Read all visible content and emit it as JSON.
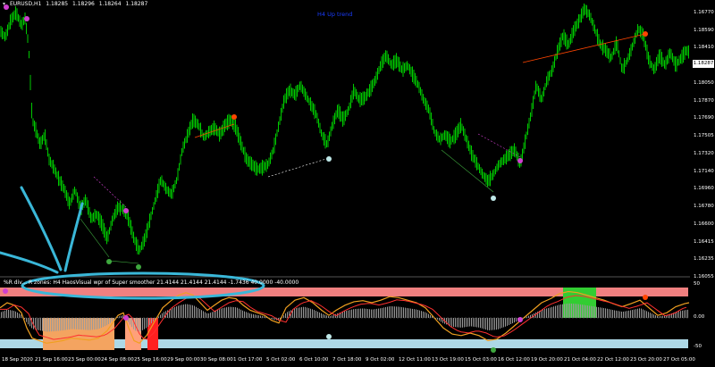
{
  "window": {
    "symbol_icon": "down-arrow-icon",
    "symbol": "EURUSD,H1",
    "ohlc": [
      "1.18285",
      "1.18296",
      "1.18264",
      "1.18287"
    ],
    "center_title": "H4 Up trend"
  },
  "indicator": {
    "caption": "%R div... R zones: H4 HaosVisual wpr of Super smoother 21.4144 21.4144 21.4144 -1.7436 40.0000 -40.0000",
    "axis": [
      "50",
      "0.00",
      "-50"
    ]
  },
  "price_axis": [
    "1.16770",
    "1.18590",
    "1.18410",
    "1.18230",
    "1.18050",
    "1.17870",
    "1.17690",
    "1.17505",
    "1.17320",
    "1.17140",
    "1.16960",
    "1.16780",
    "1.16600",
    "1.16415",
    "1.16235",
    "1.16055"
  ],
  "current_price": "1.18287",
  "time_axis": [
    "18 Sep 2020",
    "21 Sep 16:00",
    "23 Sep 00:00",
    "24 Sep 08:00",
    "25 Sep 16:00",
    "29 Sep 00:00",
    "30 Sep 08:00",
    "1 Oct 17:00",
    "5 Oct 02:00",
    "6 Oct 10:00",
    "7 Oct 18:00",
    "9 Oct 02:00",
    "12 Oct 11:00",
    "13 Oct 19:00",
    "15 Oct 03:00",
    "16 Oct 12:00",
    "19 Oct 20:00",
    "21 Oct 04:00",
    "22 Oct 12:00",
    "23 Oct 20:00",
    "27 Oct 05:00"
  ],
  "colors": {
    "background": "#000000",
    "candles": "#00c800",
    "bear_div": "#ff4500",
    "bull_div": "#ffffff",
    "up_zone": "#f08080",
    "down_zone": "#add8e6",
    "annotation": "#3ab7d8",
    "title": "#1a3cff"
  },
  "price_path": [
    [
      0,
      1.185
    ],
    [
      6,
      1.1843
    ],
    [
      12,
      1.186
    ],
    [
      18,
      1.1868
    ],
    [
      24,
      1.1855
    ],
    [
      28,
      1.1862
    ],
    [
      32,
      1.1835
    ],
    [
      36,
      1.176
    ],
    [
      40,
      1.175
    ],
    [
      45,
      1.1735
    ],
    [
      50,
      1.1745
    ],
    [
      55,
      1.172
    ],
    [
      60,
      1.1712
    ],
    [
      66,
      1.17
    ],
    [
      72,
      1.169
    ],
    [
      78,
      1.1675
    ],
    [
      84,
      1.169
    ],
    [
      90,
      1.167
    ],
    [
      96,
      1.168
    ],
    [
      102,
      1.166
    ],
    [
      108,
      1.1665
    ],
    [
      114,
      1.1655
    ],
    [
      120,
      1.164
    ],
    [
      126,
      1.166
    ],
    [
      132,
      1.1672
    ],
    [
      138,
      1.167
    ],
    [
      144,
      1.166
    ],
    [
      150,
      1.164
    ],
    [
      156,
      1.1628
    ],
    [
      162,
      1.164
    ],
    [
      168,
      1.166
    ],
    [
      174,
      1.168
    ],
    [
      180,
      1.17
    ],
    [
      186,
      1.169
    ],
    [
      192,
      1.1685
    ],
    [
      198,
      1.17
    ],
    [
      204,
      1.173
    ],
    [
      210,
      1.1745
    ],
    [
      216,
      1.176
    ],
    [
      222,
      1.1755
    ],
    [
      228,
      1.1742
    ],
    [
      234,
      1.1748
    ],
    [
      240,
      1.1752
    ],
    [
      246,
      1.1745
    ],
    [
      252,
      1.1755
    ],
    [
      258,
      1.176
    ],
    [
      264,
      1.1752
    ],
    [
      270,
      1.1735
    ],
    [
      276,
      1.172
    ],
    [
      282,
      1.1715
    ],
    [
      288,
      1.171
    ],
    [
      294,
      1.1712
    ],
    [
      300,
      1.1715
    ],
    [
      306,
      1.173
    ],
    [
      312,
      1.1755
    ],
    [
      318,
      1.178
    ],
    [
      324,
      1.179
    ],
    [
      330,
      1.1785
    ],
    [
      336,
      1.1795
    ],
    [
      342,
      1.1785
    ],
    [
      348,
      1.1775
    ],
    [
      354,
      1.1765
    ],
    [
      360,
      1.1745
    ],
    [
      366,
      1.1735
    ],
    [
      372,
      1.1755
    ],
    [
      378,
      1.177
    ],
    [
      384,
      1.176
    ],
    [
      390,
      1.177
    ],
    [
      396,
      1.179
    ],
    [
      402,
      1.178
    ],
    [
      408,
      1.1782
    ],
    [
      414,
      1.179
    ],
    [
      420,
      1.18
    ],
    [
      426,
      1.1815
    ],
    [
      432,
      1.1825
    ],
    [
      438,
      1.1815
    ],
    [
      444,
      1.182
    ],
    [
      450,
      1.181
    ],
    [
      456,
      1.1815
    ],
    [
      462,
      1.1805
    ],
    [
      468,
      1.1795
    ],
    [
      474,
      1.178
    ],
    [
      480,
      1.177
    ],
    [
      486,
      1.1748
    ],
    [
      492,
      1.174
    ],
    [
      498,
      1.1745
    ],
    [
      504,
      1.1738
    ],
    [
      510,
      1.1745
    ],
    [
      516,
      1.1755
    ],
    [
      522,
      1.174
    ],
    [
      528,
      1.1725
    ],
    [
      534,
      1.1715
    ],
    [
      540,
      1.1705
    ],
    [
      546,
      1.1698
    ],
    [
      552,
      1.1705
    ],
    [
      558,
      1.1715
    ],
    [
      564,
      1.172
    ],
    [
      570,
      1.1725
    ],
    [
      576,
      1.173
    ],
    [
      582,
      1.1715
    ],
    [
      588,
      1.174
    ],
    [
      594,
      1.1765
    ],
    [
      600,
      1.1795
    ],
    [
      606,
      1.178
    ],
    [
      612,
      1.18
    ],
    [
      618,
      1.181
    ],
    [
      624,
      1.183
    ],
    [
      630,
      1.1845
    ],
    [
      636,
      1.1835
    ],
    [
      642,
      1.185
    ],
    [
      648,
      1.186
    ],
    [
      654,
      1.1872
    ],
    [
      660,
      1.1865
    ],
    [
      666,
      1.185
    ],
    [
      672,
      1.1835
    ],
    [
      678,
      1.183
    ],
    [
      684,
      1.1822
    ],
    [
      690,
      1.1838
    ],
    [
      696,
      1.181
    ],
    [
      702,
      1.182
    ],
    [
      708,
      1.1835
    ],
    [
      714,
      1.1852
    ],
    [
      720,
      1.1845
    ],
    [
      726,
      1.182
    ],
    [
      732,
      1.181
    ],
    [
      738,
      1.1825
    ],
    [
      744,
      1.1815
    ],
    [
      750,
      1.1828
    ],
    [
      756,
      1.1815
    ],
    [
      762,
      1.1822
    ],
    [
      768,
      1.183
    ],
    [
      771,
      1.1828
    ]
  ],
  "price_scale": {
    "min": 1.16055,
    "max": 1.1877
  },
  "indicator_wpr": [
    [
      0,
      20
    ],
    [
      8,
      30
    ],
    [
      16,
      25
    ],
    [
      24,
      10
    ],
    [
      30,
      -20
    ],
    [
      36,
      -40
    ],
    [
      44,
      -45
    ],
    [
      52,
      -50
    ],
    [
      60,
      -48
    ],
    [
      70,
      -45
    ],
    [
      80,
      -40
    ],
    [
      90,
      -42
    ],
    [
      100,
      -44
    ],
    [
      110,
      -40
    ],
    [
      120,
      -25
    ],
    [
      126,
      -10
    ],
    [
      132,
      5
    ],
    [
      138,
      10
    ],
    [
      144,
      -20
    ],
    [
      150,
      -45
    ],
    [
      156,
      -50
    ],
    [
      164,
      -35
    ],
    [
      172,
      -10
    ],
    [
      182,
      20
    ],
    [
      192,
      35
    ],
    [
      200,
      45
    ],
    [
      208,
      50
    ],
    [
      216,
      45
    ],
    [
      224,
      30
    ],
    [
      232,
      15
    ],
    [
      240,
      25
    ],
    [
      248,
      35
    ],
    [
      256,
      40
    ],
    [
      264,
      38
    ],
    [
      272,
      25
    ],
    [
      280,
      15
    ],
    [
      288,
      10
    ],
    [
      296,
      5
    ],
    [
      304,
      -5
    ],
    [
      312,
      -10
    ],
    [
      320,
      20
    ],
    [
      330,
      35
    ],
    [
      340,
      40
    ],
    [
      350,
      30
    ],
    [
      360,
      15
    ],
    [
      368,
      5
    ],
    [
      376,
      15
    ],
    [
      386,
      25
    ],
    [
      396,
      32
    ],
    [
      406,
      34
    ],
    [
      416,
      30
    ],
    [
      426,
      35
    ],
    [
      436,
      42
    ],
    [
      446,
      40
    ],
    [
      456,
      35
    ],
    [
      466,
      30
    ],
    [
      476,
      20
    ],
    [
      486,
      0
    ],
    [
      496,
      -20
    ],
    [
      506,
      -32
    ],
    [
      516,
      -35
    ],
    [
      526,
      -30
    ],
    [
      536,
      -35
    ],
    [
      546,
      -45
    ],
    [
      556,
      -42
    ],
    [
      566,
      -30
    ],
    [
      576,
      -15
    ],
    [
      586,
      0
    ],
    [
      596,
      15
    ],
    [
      606,
      30
    ],
    [
      616,
      38
    ],
    [
      626,
      48
    ],
    [
      636,
      52
    ],
    [
      646,
      50
    ],
    [
      656,
      45
    ],
    [
      666,
      40
    ],
    [
      676,
      35
    ],
    [
      686,
      28
    ],
    [
      696,
      22
    ],
    [
      706,
      28
    ],
    [
      716,
      35
    ],
    [
      726,
      20
    ],
    [
      736,
      5
    ],
    [
      746,
      10
    ],
    [
      756,
      22
    ],
    [
      766,
      28
    ],
    [
      771,
      30
    ]
  ],
  "indicator_scale": {
    "min": -60,
    "max": 60
  }
}
